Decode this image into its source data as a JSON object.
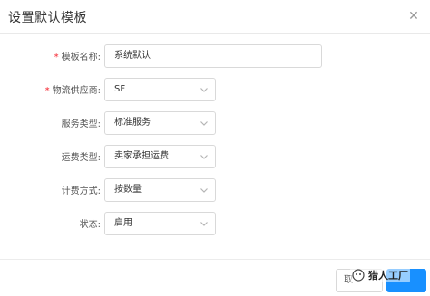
{
  "dialog": {
    "title": "设置默认模板",
    "close_symbol": "✕"
  },
  "form": {
    "template_name": {
      "label": "模板名称:",
      "required": "*",
      "value": "系统默认"
    },
    "logistics_provider": {
      "label": "物流供应商:",
      "required": "*",
      "value": "SF"
    },
    "service_type": {
      "label": "服务类型:",
      "value": "标准服务"
    },
    "freight_type": {
      "label": "运费类型:",
      "value": "卖家承担运费"
    },
    "billing_method": {
      "label": "计费方式:",
      "value": "按数量"
    },
    "status": {
      "label": "状态:",
      "value": "启用"
    }
  },
  "footer": {
    "cancel_label": "取"
  },
  "watermark": {
    "text": "猎人工厂"
  },
  "icons": {
    "select_arrow": "chevron-down-icon",
    "close": "close-icon"
  },
  "colors": {
    "primary": "#1890ff",
    "required": "#f5222d",
    "border": "#d9d9d9"
  }
}
